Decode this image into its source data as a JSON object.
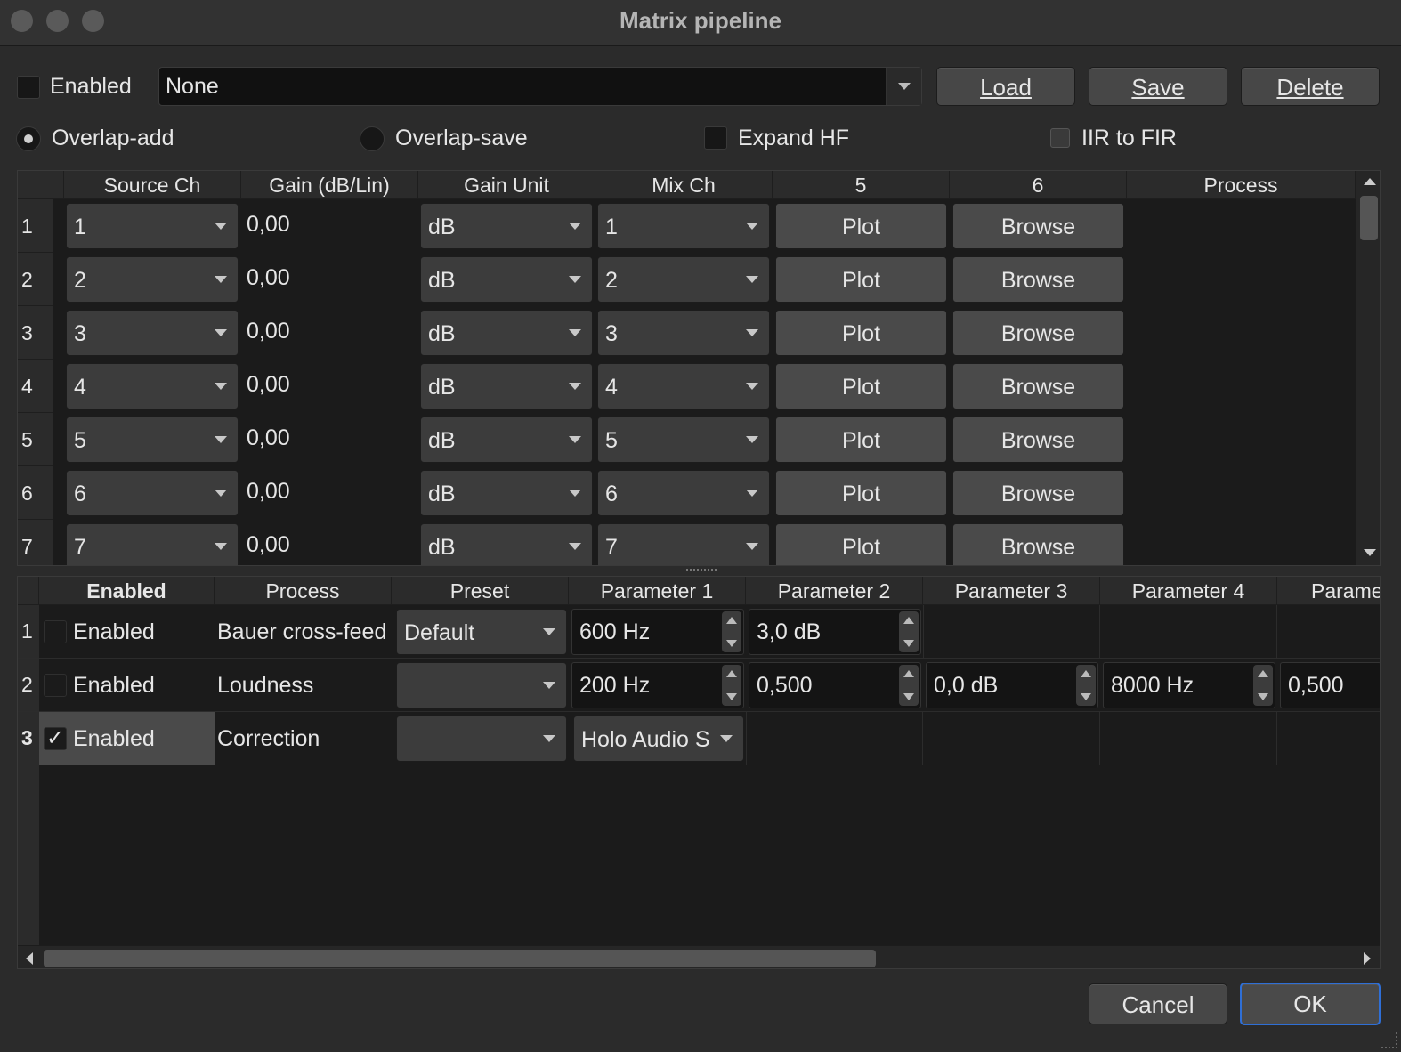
{
  "window": {
    "title": "Matrix pipeline"
  },
  "top": {
    "enabled_label": "Enabled",
    "preset_value": "None",
    "load_label": "Load",
    "save_label": "Save",
    "delete_label": "Delete"
  },
  "options": {
    "overlap_add": "Overlap-add",
    "overlap_save": "Overlap-save",
    "expand_hf": "Expand HF",
    "iir_to_fir": "IIR to FIR"
  },
  "matrix": {
    "headers": [
      "Source Ch",
      "Gain (dB/Lin)",
      "Gain Unit",
      "Mix Ch",
      "5",
      "6",
      "Process"
    ],
    "rows": [
      {
        "num": "1",
        "source": "1",
        "gain": "0,00",
        "unit": "dB",
        "mix": "1",
        "plot": "Plot",
        "browse": "Browse"
      },
      {
        "num": "2",
        "source": "2",
        "gain": "0,00",
        "unit": "dB",
        "mix": "2",
        "plot": "Plot",
        "browse": "Browse"
      },
      {
        "num": "3",
        "source": "3",
        "gain": "0,00",
        "unit": "dB",
        "mix": "3",
        "plot": "Plot",
        "browse": "Browse"
      },
      {
        "num": "4",
        "source": "4",
        "gain": "0,00",
        "unit": "dB",
        "mix": "4",
        "plot": "Plot",
        "browse": "Browse"
      },
      {
        "num": "5",
        "source": "5",
        "gain": "0,00",
        "unit": "dB",
        "mix": "5",
        "plot": "Plot",
        "browse": "Browse"
      },
      {
        "num": "6",
        "source": "6",
        "gain": "0,00",
        "unit": "dB",
        "mix": "6",
        "plot": "Plot",
        "browse": "Browse"
      },
      {
        "num": "7",
        "source": "7",
        "gain": "0,00",
        "unit": "dB",
        "mix": "7",
        "plot": "Plot",
        "browse": "Browse"
      }
    ]
  },
  "process": {
    "headers": [
      "Enabled",
      "Process",
      "Preset",
      "Parameter 1",
      "Parameter 2",
      "Parameter 3",
      "Parameter 4",
      "Parame"
    ],
    "rows": [
      {
        "num": "1",
        "enabled": "Enabled",
        "checked": false,
        "process": "Bauer cross-feed",
        "preset": "Default",
        "p1": "600 Hz",
        "p2": "3,0 dB",
        "p3": "",
        "p4": "",
        "p5": ""
      },
      {
        "num": "2",
        "enabled": "Enabled",
        "checked": false,
        "process": "Loudness",
        "preset": "",
        "p1": "200 Hz",
        "p2": "0,500",
        "p3": "0,0 dB",
        "p4": "8000 Hz",
        "p5": "0,500"
      },
      {
        "num": "3",
        "enabled": "Enabled",
        "checked": true,
        "check_mark": "✓",
        "process": "Correction",
        "preset": "",
        "p1_combo": "Holo Audio Spring",
        "p2": "",
        "p3": "",
        "p4": "",
        "p5": ""
      }
    ]
  },
  "footer": {
    "cancel_label": "Cancel",
    "ok_label": "OK"
  }
}
